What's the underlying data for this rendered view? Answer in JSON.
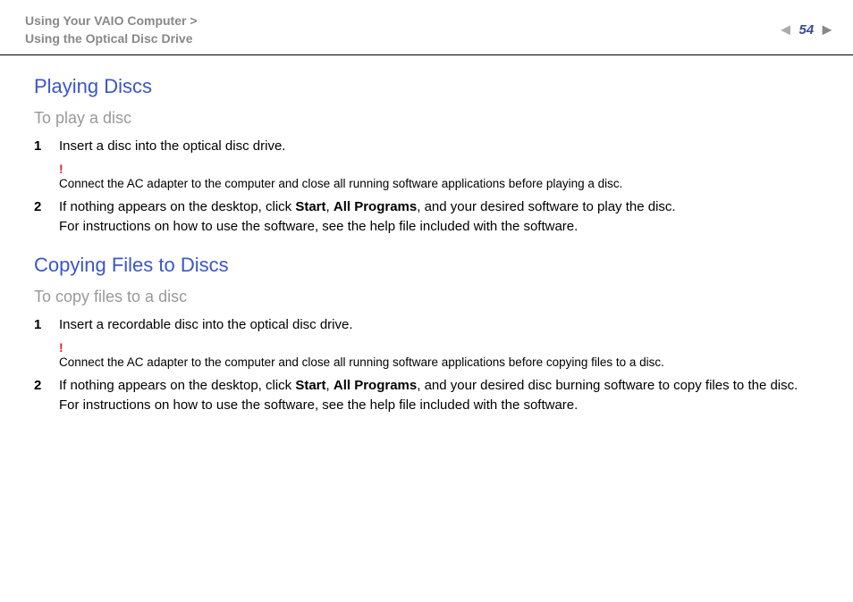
{
  "header": {
    "breadcrumb_line1": "Using Your VAIO Computer >",
    "breadcrumb_line2": "Using the Optical Disc Drive",
    "page_number": "54"
  },
  "section1": {
    "title": "Playing Discs",
    "subtitle": "To play a disc",
    "step1_num": "1",
    "step1_text": "Insert a disc into the optical disc drive.",
    "warning_mark": "!",
    "warning_text": "Connect the AC adapter to the computer and close all running software applications before playing a disc.",
    "step2_num": "2",
    "step2_prefix": "If nothing appears on the desktop, click ",
    "step2_bold1": "Start",
    "step2_sep": ", ",
    "step2_bold2": "All Programs",
    "step2_suffix": ", and your desired software to play the disc.",
    "step2_line2": "For instructions on how to use the software, see the help file included with the software."
  },
  "section2": {
    "title": "Copying Files to Discs",
    "subtitle": "To copy files to a disc",
    "step1_num": "1",
    "step1_text": "Insert a recordable disc into the optical disc drive.",
    "warning_mark": "!",
    "warning_text": "Connect the AC adapter to the computer and close all running software applications before copying files to a disc.",
    "step2_num": "2",
    "step2_prefix": "If nothing appears on the desktop, click ",
    "step2_bold1": "Start",
    "step2_sep": ", ",
    "step2_bold2": "All Programs",
    "step2_suffix": ", and your desired disc burning software to copy files to the disc.",
    "step2_line2": "For instructions on how to use the software, see the help file included with the software."
  }
}
